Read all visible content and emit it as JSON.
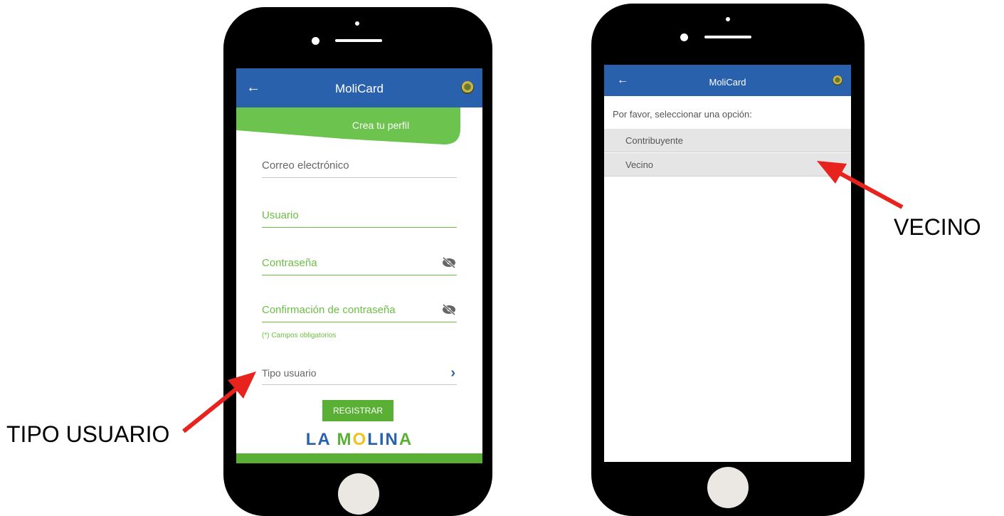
{
  "phone_left": {
    "app_title": "MoliCard",
    "banner": "Crea tu perfil",
    "fields": {
      "email": "Correo electrónico",
      "user": "Usuario",
      "password": "Contraseña",
      "confirm": "Confirmación de contraseña",
      "required_note": "(*) Campos obligatorios",
      "user_type": "Tipo usuario"
    },
    "register_button": "REGISTRAR",
    "brand": {
      "part1": "LA ",
      "m": "M",
      "o": "O",
      "lin": "LIN",
      "a": "A"
    }
  },
  "phone_right": {
    "app_title": "MoliCard",
    "prompt": "Por favor, seleccionar una opción:",
    "options": [
      "Contribuyente",
      "Vecino"
    ]
  },
  "annotations": {
    "left_label": "TIPO USUARIO",
    "right_label": "VECINO"
  },
  "colors": {
    "appbar": "#2a61ac",
    "green": "#6cbf46",
    "button": "#5ab035",
    "arrow": "#e8231d"
  }
}
